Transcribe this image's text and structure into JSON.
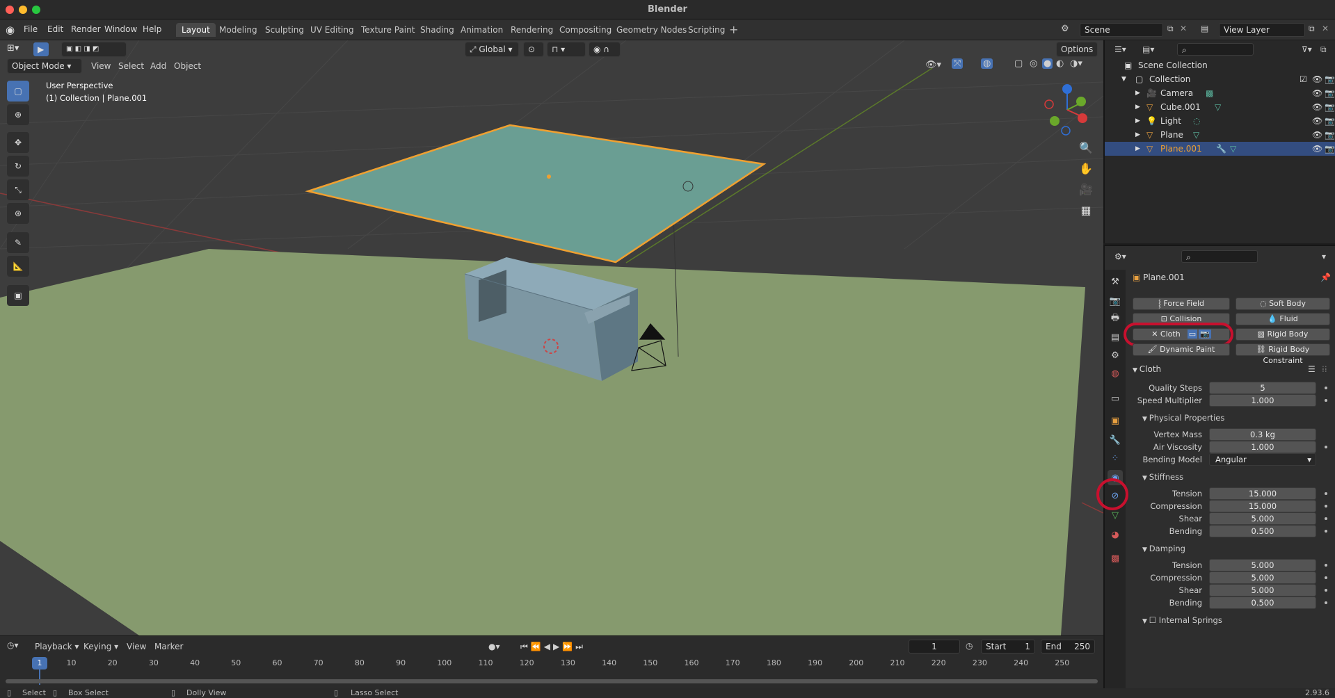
{
  "window": {
    "title": "Blender"
  },
  "menu": [
    "File",
    "Edit",
    "Render",
    "Window",
    "Help"
  ],
  "workspaces": [
    "Layout",
    "Modeling",
    "Sculpting",
    "UV Editing",
    "Texture Paint",
    "Shading",
    "Animation",
    "Rendering",
    "Compositing",
    "Geometry Nodes",
    "Scripting"
  ],
  "active_workspace": "Layout",
  "scene": {
    "name": "Scene",
    "view_layer": "View Layer"
  },
  "viewport": {
    "mode": "Object Mode",
    "menus": [
      "View",
      "Select",
      "Add",
      "Object"
    ],
    "transform_orientation": "Global",
    "options_label": "Options",
    "overlay_title": "User Perspective",
    "overlay_subtitle": "(1) Collection | Plane.001"
  },
  "outliner": {
    "root": "Scene Collection",
    "collection": "Collection",
    "items": [
      {
        "name": "Camera",
        "selected": false
      },
      {
        "name": "Cube.001",
        "selected": false
      },
      {
        "name": "Light",
        "selected": false
      },
      {
        "name": "Plane",
        "selected": false
      },
      {
        "name": "Plane.001",
        "selected": true
      }
    ]
  },
  "properties": {
    "object_name": "Plane.001",
    "physics_buttons": {
      "force_field": "Force Field",
      "soft_body": "Soft Body",
      "collision": "Collision",
      "fluid": "Fluid",
      "cloth": "Cloth",
      "rigid_body": "Rigid Body",
      "dynamic_paint": "Dynamic Paint",
      "rigid_body_constraint": "Rigid Body Constraint"
    },
    "cloth_panel": {
      "title": "Cloth",
      "quality_steps": {
        "label": "Quality Steps",
        "value": "5"
      },
      "speed_multiplier": {
        "label": "Speed Multiplier",
        "value": "1.000"
      },
      "physical": {
        "title": "Physical Properties",
        "vertex_mass": {
          "label": "Vertex Mass",
          "value": "0.3 kg"
        },
        "air_viscosity": {
          "label": "Air Viscosity",
          "value": "1.000"
        },
        "bending_model": {
          "label": "Bending Model",
          "value": "Angular"
        }
      },
      "stiffness": {
        "title": "Stiffness",
        "tension": {
          "label": "Tension",
          "value": "15.000"
        },
        "compression": {
          "label": "Compression",
          "value": "15.000"
        },
        "shear": {
          "label": "Shear",
          "value": "5.000"
        },
        "bending": {
          "label": "Bending",
          "value": "0.500"
        }
      },
      "damping": {
        "title": "Damping",
        "tension": {
          "label": "Tension",
          "value": "5.000"
        },
        "compression": {
          "label": "Compression",
          "value": "5.000"
        },
        "shear": {
          "label": "Shear",
          "value": "5.000"
        },
        "bending": {
          "label": "Bending",
          "value": "0.500"
        }
      },
      "internal_springs": "Internal Springs"
    }
  },
  "timeline": {
    "menus": [
      "Playback",
      "Keying",
      "View",
      "Marker"
    ],
    "current_frame": "1",
    "start_label": "Start",
    "start": "1",
    "end_label": "End",
    "end": "250",
    "ticks": [
      "1",
      "10",
      "20",
      "30",
      "40",
      "50",
      "60",
      "70",
      "80",
      "90",
      "100",
      "110",
      "120",
      "130",
      "140",
      "150",
      "160",
      "170",
      "180",
      "190",
      "200",
      "210",
      "220",
      "230",
      "240",
      "250"
    ]
  },
  "statusbar": {
    "select": "Select",
    "box_select": "Box Select",
    "dolly_view": "Dolly View",
    "lasso_select": "Lasso Select",
    "version": "2.93.6"
  },
  "colors": {
    "accent": "#4772b3",
    "selection_orange": "#f0a030",
    "highlight_red": "#c8102e",
    "ground": "#869a6e",
    "plane": "#6a9e93"
  }
}
